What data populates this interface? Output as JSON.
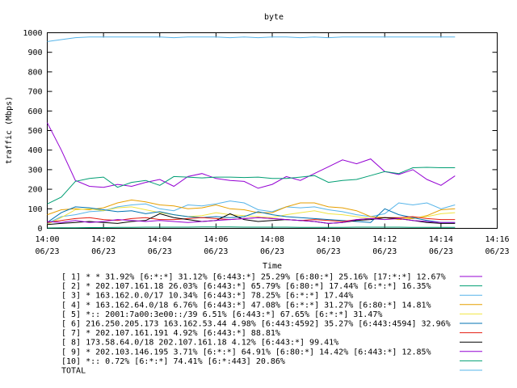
{
  "chart_data": {
    "type": "line",
    "title": "byte",
    "xlabel": "Time",
    "ylabel": "traffic (Mbps)",
    "ylim": [
      0,
      1000
    ],
    "xlim": [
      "2023-06-23 14:00",
      "2023-06-23 14:16"
    ],
    "yticks": [
      0,
      100,
      200,
      300,
      400,
      500,
      600,
      700,
      800,
      900,
      1000
    ],
    "xticks": [
      {
        "time": "14:00",
        "date": "06/23"
      },
      {
        "time": "14:02",
        "date": "06/23"
      },
      {
        "time": "14:04",
        "date": "06/23"
      },
      {
        "time": "14:06",
        "date": "06/23"
      },
      {
        "time": "14:08",
        "date": "06/23"
      },
      {
        "time": "14:10",
        "date": "06/23"
      },
      {
        "time": "14:12",
        "date": "06/23"
      },
      {
        "time": "14:14",
        "date": "06/23"
      },
      {
        "time": "14:16",
        "date": "06/23"
      }
    ],
    "x_minutes": [
      0,
      0.5,
      1,
      1.5,
      2,
      2.5,
      3,
      3.5,
      4,
      4.5,
      5,
      5.5,
      6,
      6.5,
      7,
      7.5,
      8,
      8.5,
      9,
      9.5,
      10,
      10.5,
      11,
      11.5,
      12,
      12.5,
      13,
      13.5,
      14,
      14.5
    ],
    "grid": false,
    "legend_position": "bottom",
    "series": [
      {
        "name": "[ 1] * * 31.92%  [6:*:*] 31.12% [6:443:*] 25.29% [6:80:*] 25.16% [17:*:*] 12.67%",
        "color": "#9400d3",
        "values": [
          540,
          400,
          245,
          215,
          210,
          225,
          215,
          235,
          250,
          215,
          265,
          280,
          255,
          245,
          240,
          205,
          225,
          265,
          245,
          280,
          315,
          350,
          330,
          355,
          290,
          275,
          300,
          250,
          220,
          268
        ]
      },
      {
        "name": "[ 2] * 202.107.161.18 26.03%  [6:443:*] 65.79% [6:80:*] 17.44% [6:*:*] 16.35%",
        "color": "#009e73",
        "values": [
          125,
          160,
          240,
          255,
          262,
          210,
          235,
          245,
          220,
          265,
          262,
          258,
          262,
          262,
          260,
          262,
          255,
          255,
          262,
          270,
          235,
          245,
          250,
          270,
          290,
          280,
          310,
          312,
          310,
          310
        ]
      },
      {
        "name": "[ 3] * 163.162.0.0/17 10.34%  [6:443:*] 78.25% [6:*:*] 17.44%",
        "color": "#56b4e9",
        "values": [
          25,
          60,
          70,
          85,
          90,
          110,
          120,
          125,
          100,
          90,
          120,
          115,
          125,
          140,
          130,
          95,
          85,
          110,
          105,
          110,
          95,
          85,
          70,
          60,
          75,
          130,
          120,
          130,
          100,
          120
        ]
      },
      {
        "name": "[ 4] * 163.162.64.0/18 6.76%  [6:443:*] 47.08% [6:*:*] 31.27% [6:80:*] 14.81%",
        "color": "#e69f00",
        "values": [
          70,
          95,
          100,
          95,
          105,
          130,
          145,
          135,
          120,
          115,
          100,
          105,
          120,
          100,
          95,
          80,
          80,
          110,
          130,
          130,
          110,
          105,
          90,
          60,
          55,
          45,
          50,
          65,
          95,
          100
        ]
      },
      {
        "name": "[ 5] *:: 2001:7a00:3e00::/39 6.51%  [6:443:*] 67.65% [6:*:*] 31.47%",
        "color": "#f0e442",
        "values": [
          20,
          55,
          95,
          100,
          90,
          105,
          110,
          95,
          80,
          70,
          60,
          65,
          80,
          70,
          65,
          60,
          55,
          70,
          80,
          90,
          75,
          70,
          60,
          50,
          45,
          50,
          55,
          60,
          75,
          80
        ]
      },
      {
        "name": "[ 6] 216.250.205.173 163.162.53.44 4.98%  [6:443:4592] 35.27% [6:443:4594] 32.96%",
        "color": "#0072b2",
        "values": [
          30,
          80,
          110,
          105,
          95,
          85,
          90,
          75,
          85,
          70,
          60,
          55,
          60,
          55,
          60,
          85,
          70,
          60,
          55,
          50,
          45,
          40,
          35,
          30,
          100,
          70,
          55,
          40,
          30,
          30
        ]
      },
      {
        "name": "[ 7] * 202.107.161.191 4.92%  [6:443:*] 88.81%",
        "color": "#e51e10",
        "values": [
          30,
          40,
          50,
          55,
          45,
          40,
          50,
          55,
          45,
          45,
          50,
          55,
          50,
          45,
          50,
          55,
          50,
          45,
          40,
          45,
          40,
          35,
          45,
          50,
          55,
          55,
          60,
          50,
          45,
          45
        ]
      },
      {
        "name": "[ 8] 173.58.64.0/18 202.107.161.18 4.12%  [6:443:*] 99.41%",
        "color": "#000000",
        "values": [
          20,
          25,
          30,
          35,
          30,
          25,
          35,
          40,
          75,
          55,
          45,
          35,
          40,
          75,
          45,
          35,
          40,
          45,
          40,
          35,
          25,
          30,
          40,
          45,
          55,
          50,
          40,
          30,
          25,
          25
        ]
      },
      {
        "name": "[ 9] * 202.103.146.195 3.71%  [6:*:*] 64.91% [6:80:*] 14.42% [6:443:*] 12.85%",
        "color": "#9400d3",
        "values": [
          35,
          30,
          40,
          30,
          35,
          45,
          40,
          35,
          40,
          35,
          30,
          35,
          40,
          45,
          50,
          55,
          50,
          45,
          40,
          35,
          25,
          30,
          45,
          50,
          45,
          50,
          40,
          35,
          30,
          30
        ]
      },
      {
        "name": "[10] *:: 0.72%  [6:*:*] 74.41% [6:*:443] 20.86%",
        "color": "#009e73",
        "values": [
          2,
          3,
          3,
          4,
          4,
          5,
          5,
          6,
          6,
          6,
          6,
          7,
          7,
          7,
          6,
          6,
          6,
          6,
          5,
          5,
          5,
          5,
          6,
          6,
          6,
          6,
          5,
          5,
          5,
          5
        ]
      },
      {
        "name": "TOTAL",
        "color": "#56b4e9",
        "values": [
          955,
          965,
          975,
          978,
          978,
          978,
          978,
          978,
          978,
          975,
          978,
          978,
          978,
          975,
          978,
          975,
          978,
          978,
          975,
          978,
          975,
          978,
          978,
          978,
          978,
          978,
          978,
          978,
          978,
          978
        ]
      }
    ]
  }
}
